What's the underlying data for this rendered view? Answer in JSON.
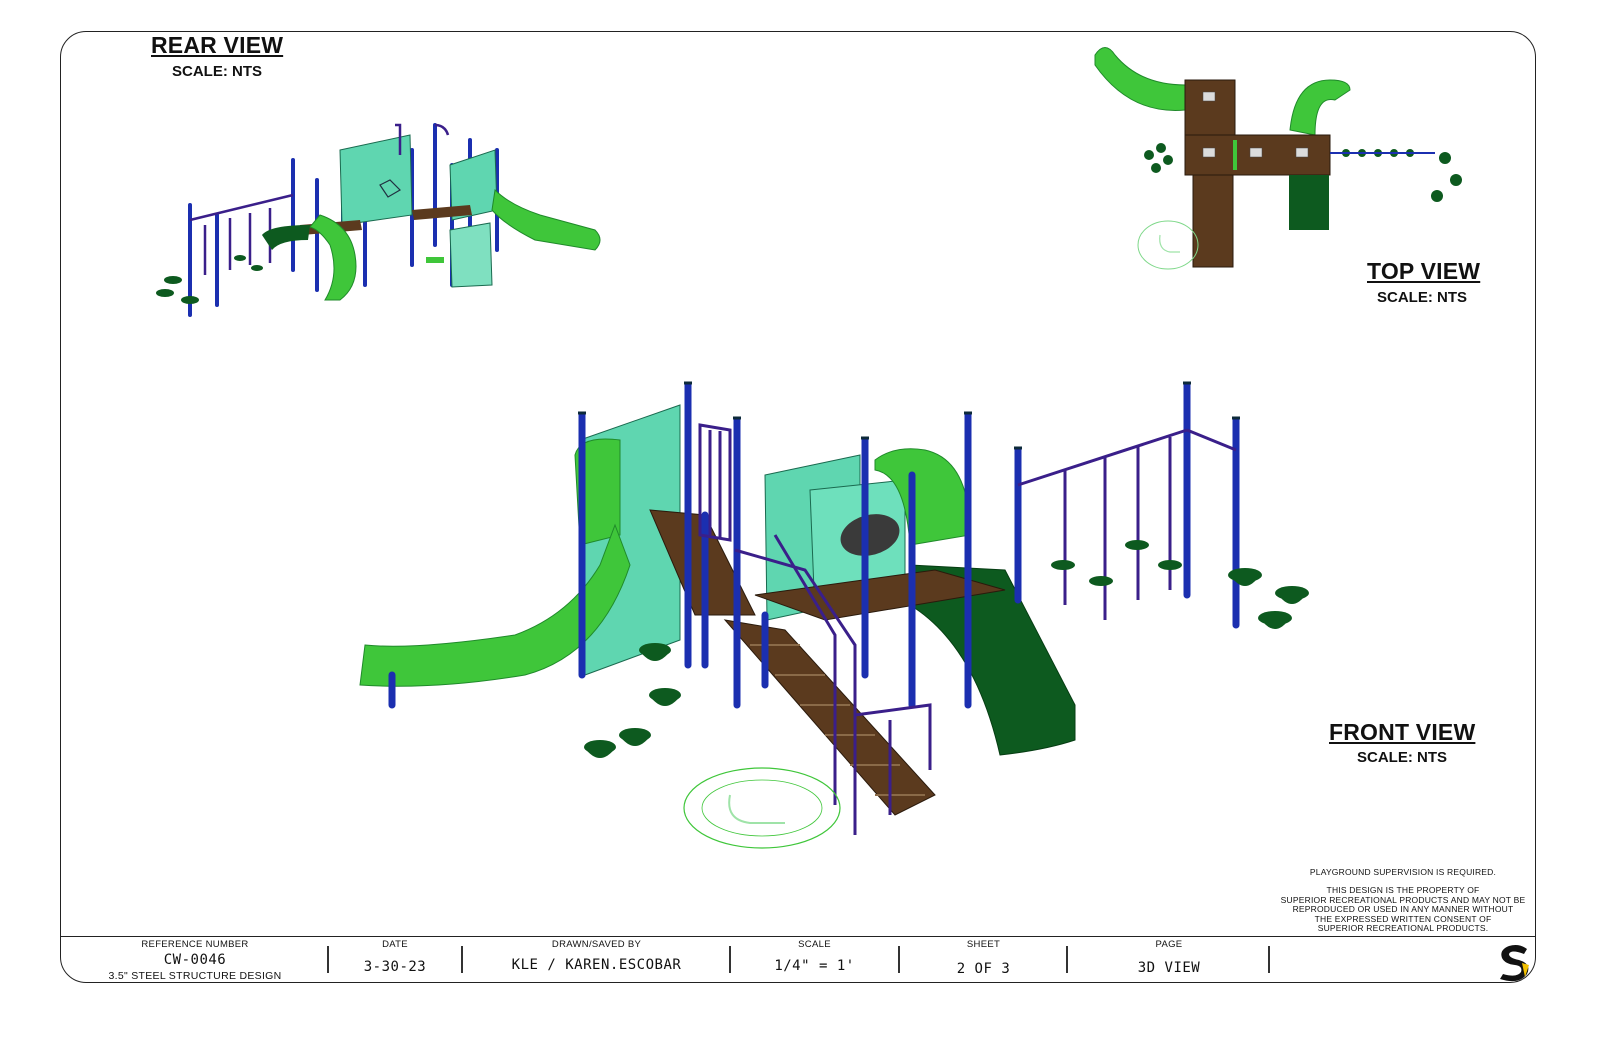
{
  "views": {
    "rear": {
      "title": "REAR VIEW",
      "scale": "SCALE: NTS"
    },
    "top": {
      "title": "TOP VIEW",
      "scale": "SCALE: NTS"
    },
    "front": {
      "title": "FRONT VIEW",
      "scale": "SCALE: NTS"
    }
  },
  "notes": {
    "supervision": "PLAYGROUND SUPERVISION IS REQUIRED.",
    "property_lines": [
      "THIS DESIGN IS THE PROPERTY OF",
      "SUPERIOR RECREATIONAL PRODUCTS AND MAY NOT BE",
      "REPRODUCED OR USED IN ANY MANNER WITHOUT",
      "THE EXPRESSED WRITTEN CONSENT OF",
      "SUPERIOR RECREATIONAL PRODUCTS."
    ]
  },
  "title_block": {
    "reference": {
      "label": "REFERENCE NUMBER",
      "value": "CW-0046",
      "sub": "3.5\" STEEL STRUCTURE DESIGN"
    },
    "date": {
      "label": "DATE",
      "value": "3-30-23"
    },
    "drawn": {
      "label": "DRAWN/SAVED BY",
      "value": "KLE / KAREN.ESCOBAR"
    },
    "scale": {
      "label": "SCALE",
      "value": "1/4\" = 1'"
    },
    "sheet": {
      "label": "SHEET",
      "value": "2 OF 3"
    },
    "page": {
      "label": "PAGE",
      "value": "3D VIEW"
    }
  },
  "colors": {
    "post_blue": "#1b2fb0",
    "slide_green": "#3fc63a",
    "dark_green": "#0d5a1f",
    "panel_teal": "#5fd6b0",
    "deck_brown": "#5b3a1e",
    "rail_purple": "#3a1f8a",
    "logo_yellow": "#f2c000"
  },
  "icons": {
    "logo": "superior-s-logo",
    "accessibility": "wheelchair-symbol-icon"
  }
}
